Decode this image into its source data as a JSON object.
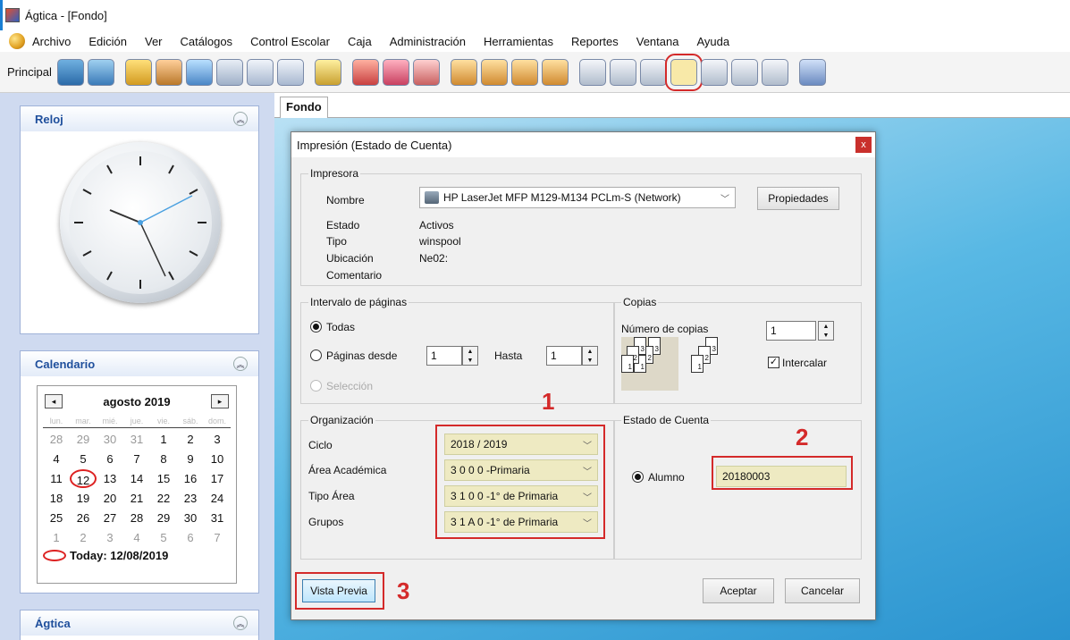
{
  "window": {
    "title": "Ágtica - [Fondo]"
  },
  "menu": [
    "Archivo",
    "Edición",
    "Ver",
    "Catálogos",
    "Control Escolar",
    "Caja",
    "Administración",
    "Herramientas",
    "Reportes",
    "Ventana",
    "Ayuda"
  ],
  "toolbar": {
    "label": "Principal"
  },
  "sidebar": {
    "reloj": {
      "title": "Reloj"
    },
    "calendario": {
      "title": "Calendario",
      "month": "agosto 2019",
      "prev": "◂",
      "next": "▸",
      "dow": [
        "lun.",
        "mar.",
        "mié.",
        "jue.",
        "vie.",
        "sáb.",
        "dom."
      ],
      "weeks": [
        [
          "28",
          "29",
          "30",
          "31",
          "1",
          "2",
          "3"
        ],
        [
          "4",
          "5",
          "6",
          "7",
          "8",
          "9",
          "10"
        ],
        [
          "11",
          "12",
          "13",
          "14",
          "15",
          "16",
          "17"
        ],
        [
          "18",
          "19",
          "20",
          "21",
          "22",
          "23",
          "24"
        ],
        [
          "25",
          "26",
          "27",
          "28",
          "29",
          "30",
          "31"
        ],
        [
          "1",
          "2",
          "3",
          "4",
          "5",
          "6",
          "7"
        ]
      ],
      "today_label": "Today: 12/08/2019"
    },
    "agtica": {
      "title": "Ágtica"
    }
  },
  "tabs": {
    "fondo": "Fondo"
  },
  "dialog": {
    "title": "Impresión (Estado de Cuenta)",
    "close": "x",
    "impresora": {
      "group": "Impresora",
      "nombre_label": "Nombre",
      "nombre_value": "HP LaserJet MFP M129-M134 PCLm-S (Network)",
      "propiedades": "Propiedades",
      "estado_label": "Estado",
      "estado_value": "Activos",
      "tipo_label": "Tipo",
      "tipo_value": "winspool",
      "ubicacion_label": "Ubicación",
      "ubicacion_value": "Ne02:",
      "comentario_label": "Comentario"
    },
    "intervalo": {
      "group": "Intervalo de páginas",
      "todas": "Todas",
      "paginas_desde": "Páginas desde",
      "desde_value": "1",
      "hasta_label": "Hasta",
      "hasta_value": "1",
      "seleccion": "Selección"
    },
    "copias": {
      "group": "Copias",
      "numero_label": "Número de copias",
      "numero_value": "1",
      "intercalar": "Intercalar",
      "intercalar_checked": true
    },
    "organizacion": {
      "group": "Organización",
      "ciclo_label": "Ciclo",
      "ciclo_value": "2018 / 2019",
      "area_label": "Área Académica",
      "area_value": "3 0 0 0 -Primaria",
      "tipo_area_label": "Tipo Área",
      "tipo_area_value": "3 1 0 0 -1° de Primaria",
      "grupos_label": "Grupos",
      "grupos_value": "3 1 A 0 -1° de Primaria"
    },
    "estado_cuenta": {
      "group": "Estado de Cuenta",
      "alumno_label": "Alumno",
      "alumno_value": "20180003"
    },
    "buttons": {
      "vista_previa": "Vista Previa",
      "aceptar": "Aceptar",
      "cancelar": "Cancelar"
    },
    "annotations": {
      "n1": "1",
      "n2": "2",
      "n3": "3"
    }
  },
  "colors": {
    "annotation": "#d42a2a",
    "sidebar_bg": "#cfdaf0",
    "panel_title": "#1f4f9c",
    "desktop": "#2a93cf"
  }
}
